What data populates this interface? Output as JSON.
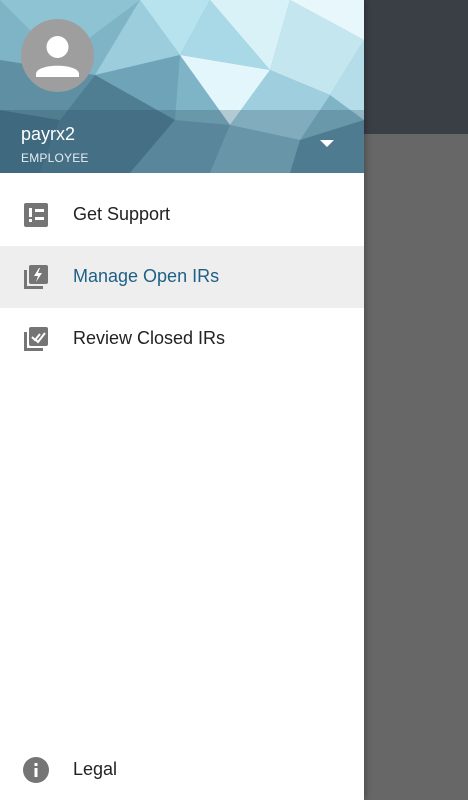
{
  "user": {
    "name": "payrx2",
    "role": "EMPLOYEE"
  },
  "menu": {
    "items": [
      {
        "label": "Get Support",
        "icon": "support-list-icon",
        "active": false
      },
      {
        "label": "Manage Open IRs",
        "icon": "open-irs-icon",
        "active": true
      },
      {
        "label": "Review Closed IRs",
        "icon": "closed-irs-icon",
        "active": false
      }
    ]
  },
  "footer": {
    "legal_label": "Legal",
    "icon": "info-icon"
  },
  "colors": {
    "active_text": "#1f5f86",
    "active_bg": "#eeeeee",
    "icon_gray": "#757575",
    "header_base": "#7fb3c6"
  }
}
